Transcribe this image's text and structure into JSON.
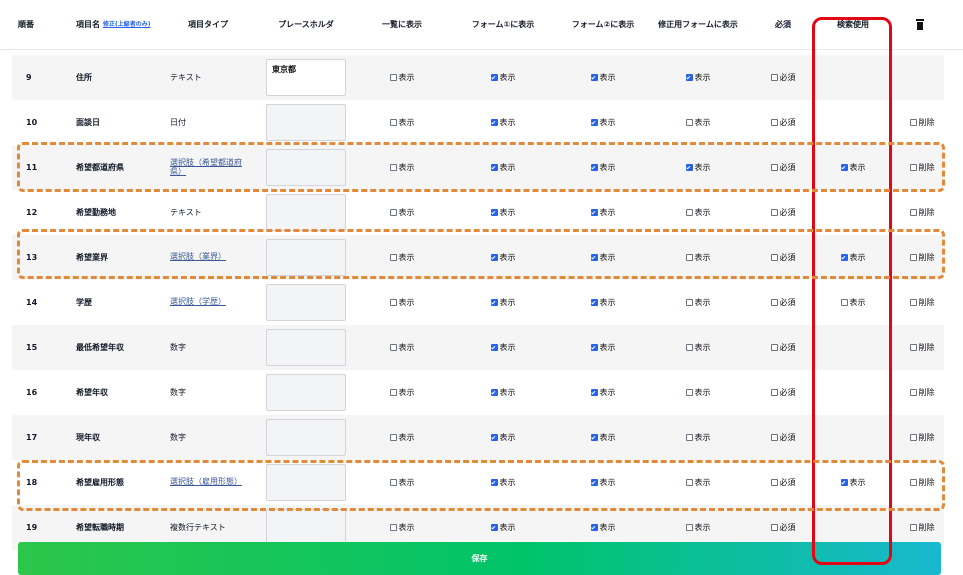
{
  "headers": {
    "order": "順番",
    "name": "項目名",
    "name_link": "修正(上級者のみ)",
    "type": "項目タイプ",
    "placeholder": "プレースホルダ",
    "list": "一覧に表示",
    "form1": "フォーム①に表示",
    "form2": "フォーム②に表示",
    "edit": "修正用フォームに表示",
    "required": "必須",
    "search": "検索使用"
  },
  "labels": {
    "show": "表示",
    "required": "必須",
    "delete": "削除"
  },
  "rows": [
    {
      "no": "9",
      "name": "住所",
      "type": "テキスト",
      "type_link": false,
      "placeholder": "東京都",
      "list": false,
      "form1": true,
      "form2": true,
      "edit": true,
      "required": false,
      "search": null,
      "deletable": false
    },
    {
      "no": "10",
      "name": "面談日",
      "type": "日付",
      "type_link": false,
      "placeholder": "",
      "list": false,
      "form1": true,
      "form2": true,
      "edit": false,
      "required": false,
      "search": null,
      "deletable": true
    },
    {
      "no": "11",
      "name": "希望都道府県",
      "type": "選択肢（希望都道府県）",
      "type_link": true,
      "placeholder": "",
      "list": false,
      "form1": true,
      "form2": true,
      "edit": true,
      "required": false,
      "search": true,
      "deletable": true
    },
    {
      "no": "12",
      "name": "希望勤務地",
      "type": "テキスト",
      "type_link": false,
      "placeholder": "",
      "list": false,
      "form1": true,
      "form2": true,
      "edit": false,
      "required": false,
      "search": null,
      "deletable": true
    },
    {
      "no": "13",
      "name": "希望業界",
      "type": "選択肢（業界）",
      "type_link": true,
      "placeholder": "",
      "list": false,
      "form1": true,
      "form2": true,
      "edit": false,
      "required": false,
      "search": true,
      "deletable": true
    },
    {
      "no": "14",
      "name": "学歴",
      "type": "選択肢（学歴）",
      "type_link": true,
      "placeholder": "",
      "list": false,
      "form1": true,
      "form2": true,
      "edit": false,
      "required": false,
      "search": false,
      "deletable": true
    },
    {
      "no": "15",
      "name": "最低希望年収",
      "type": "数字",
      "type_link": false,
      "placeholder": "",
      "list": false,
      "form1": true,
      "form2": true,
      "edit": false,
      "required": false,
      "search": null,
      "deletable": true
    },
    {
      "no": "16",
      "name": "希望年収",
      "type": "数字",
      "type_link": false,
      "placeholder": "",
      "list": false,
      "form1": true,
      "form2": true,
      "edit": false,
      "required": false,
      "search": null,
      "deletable": true
    },
    {
      "no": "17",
      "name": "現年収",
      "type": "数字",
      "type_link": false,
      "placeholder": "",
      "list": false,
      "form1": true,
      "form2": true,
      "edit": false,
      "required": false,
      "search": null,
      "deletable": true
    },
    {
      "no": "18",
      "name": "希望雇用形態",
      "type": "選択肢（雇用形態）",
      "type_link": true,
      "placeholder": "",
      "list": false,
      "form1": true,
      "form2": true,
      "edit": false,
      "required": false,
      "search": true,
      "deletable": true
    },
    {
      "no": "19",
      "name": "希望転職時期",
      "type": "複数行テキスト",
      "type_link": false,
      "placeholder": "",
      "list": false,
      "form1": true,
      "form2": true,
      "edit": false,
      "required": false,
      "search": null,
      "deletable": true
    }
  ],
  "save_label": "保存",
  "colors": {
    "accent": "#2563eb",
    "highlight_red": "#e30613",
    "highlight_orange": "#e38a3a",
    "save_start": "#2cc64a",
    "save_end": "#18b8cf"
  },
  "icons": {
    "header_delete": "trash-icon"
  }
}
